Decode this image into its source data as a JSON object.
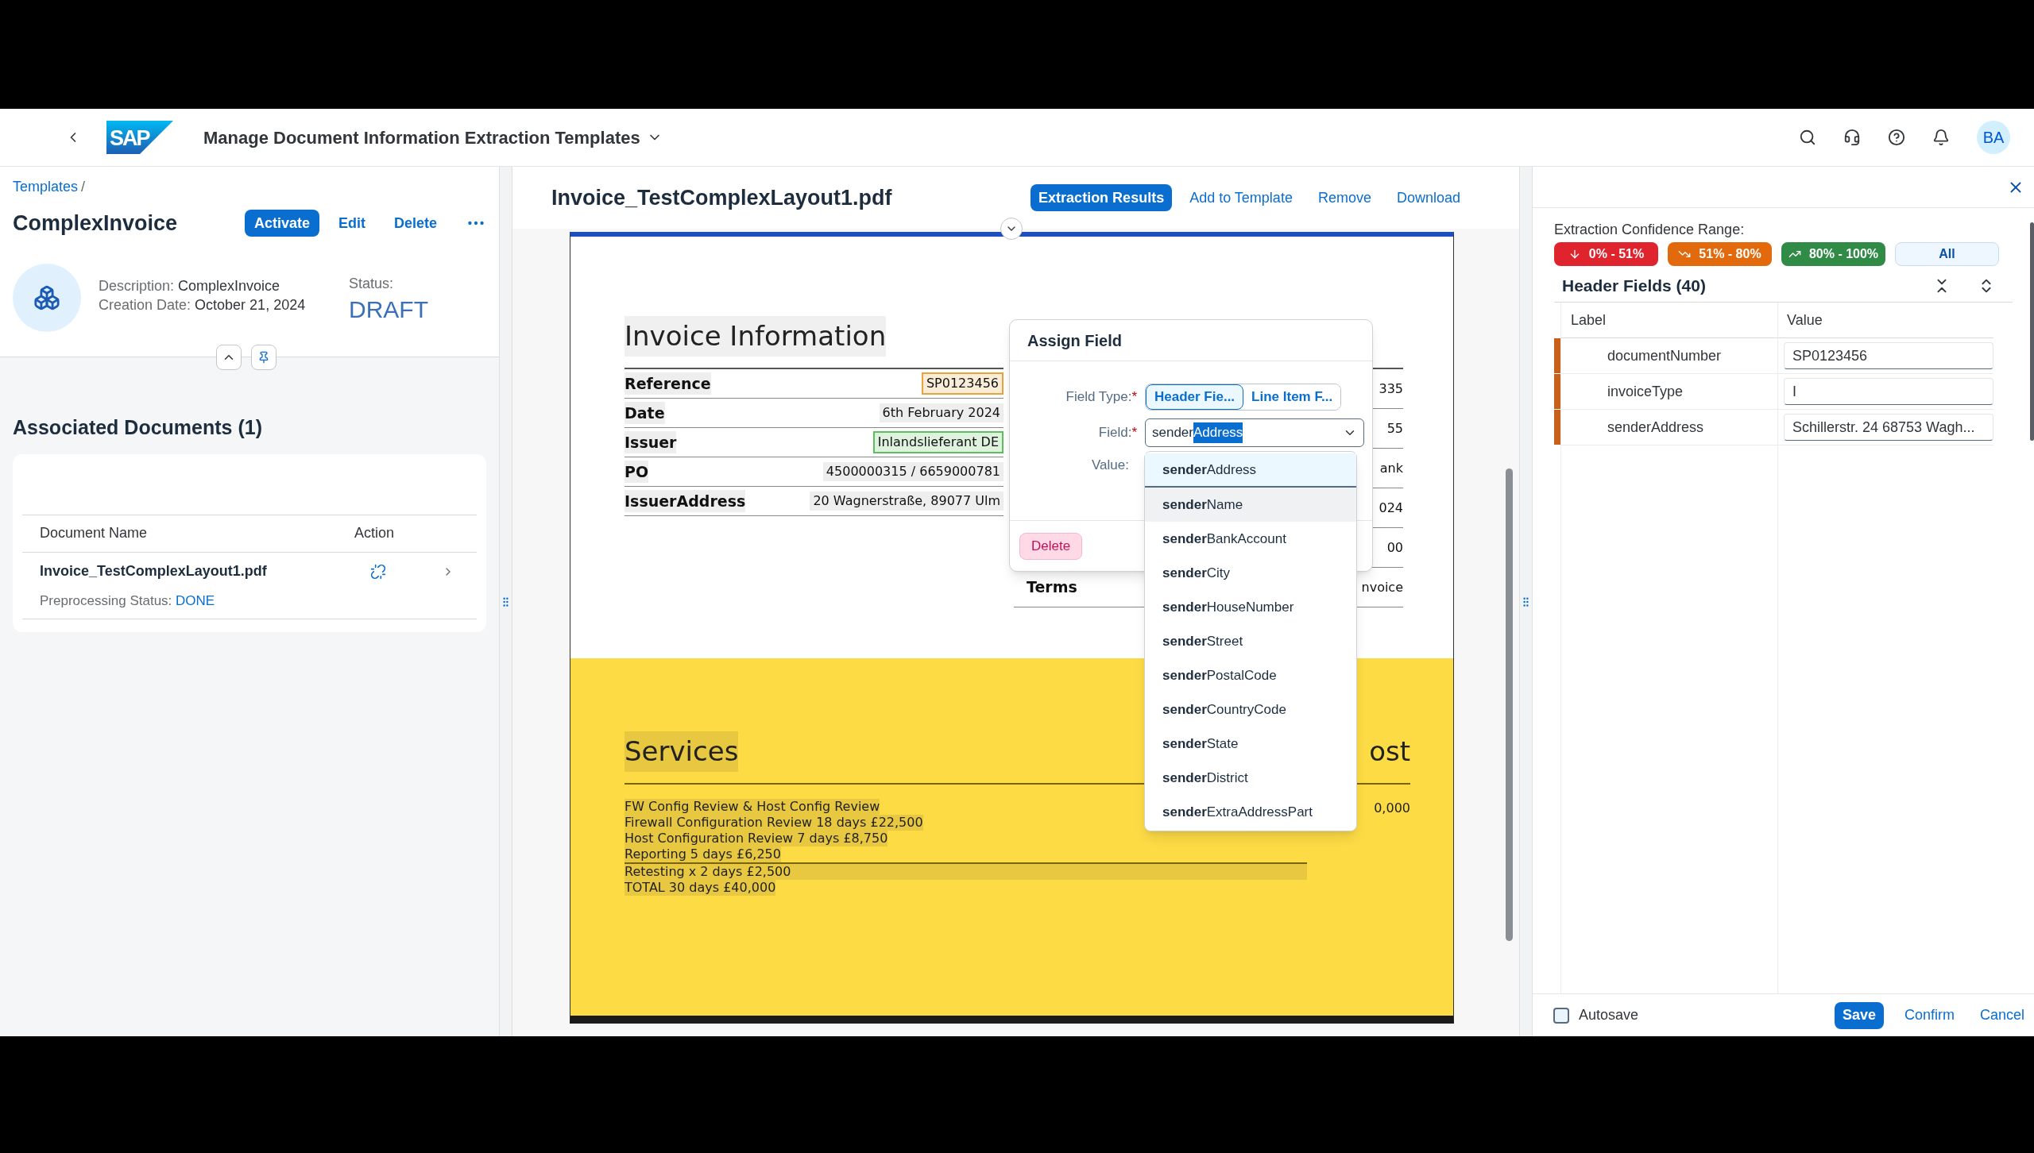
{
  "shell": {
    "logo_text": "SAP",
    "title": "Manage Document Information Extraction Templates",
    "avatar": "BA"
  },
  "template": {
    "breadcrumb": "Templates",
    "breadcrumb_separator": "/",
    "title": "ComplexInvoice",
    "actions": [
      {
        "label": "Activate",
        "kind": "emphasized"
      },
      {
        "label": "Edit",
        "kind": "transparent"
      },
      {
        "label": "Delete",
        "kind": "transparent"
      }
    ],
    "description_label": "Description:",
    "description": "ComplexInvoice",
    "creation_label": "Creation Date:",
    "creation_date": "October 21, 2024",
    "status_label": "Status:",
    "status": "DRAFT"
  },
  "associated": {
    "title": "Associated Documents (1)",
    "columns": [
      "Document Name",
      "Action"
    ],
    "rows": [
      {
        "name": "Invoice_TestComplexLayout1.pdf",
        "status_label": "Preprocessing Status:",
        "status": "DONE"
      }
    ]
  },
  "viewer": {
    "title": "Invoice_TestComplexLayout1.pdf",
    "actions": [
      {
        "label": "Extraction Results",
        "selected": true
      },
      {
        "label": "Add to Template",
        "selected": false
      },
      {
        "label": "Remove",
        "selected": false
      },
      {
        "label": "Download",
        "selected": false
      }
    ]
  },
  "document": {
    "title": "Invoice Information",
    "rows": [
      {
        "label": "Reference",
        "value": "SP0123456",
        "color": "#e8a33d"
      },
      {
        "label": "Date",
        "value": "6th February 2024"
      },
      {
        "label": "Issuer",
        "value": "Inlandslieferant DE",
        "color": "#5cc05c"
      },
      {
        "label": "PO",
        "value": "4500000315 / 6659000781"
      },
      {
        "label": "IssuerAddress",
        "value": "20 Wagnerstraße, 89077 Ulm"
      }
    ],
    "right_rows": [
      {
        "value": "335"
      },
      {
        "value": "55"
      },
      {
        "value": "ank"
      },
      {
        "value": "024"
      },
      {
        "value": "00"
      },
      {
        "label": "Terms",
        "value": "nvoice"
      }
    ],
    "services_title": "Services",
    "services_column": "ost",
    "services_amount": "0,000",
    "service_lines": [
      "FW Config Review & Host Config Review",
      "Firewall Configuration Review 18 days £22,500",
      "Host Configuration Review 7 days £8,750",
      "Reporting 5 days £6,250",
      "Retesting x 2 days £2,500",
      "TOTAL 30 days £40,000"
    ]
  },
  "assign": {
    "title": "Assign Field",
    "field_type_label": "Field Type:",
    "field_label": "Field:",
    "value_label": "Value:",
    "required_mark": "*",
    "field_types": [
      {
        "label": "Header Fie...",
        "selected": true
      },
      {
        "label": "Line Item F...",
        "selected": false
      }
    ],
    "field_typed": "sender",
    "field_autocomplete": "Address",
    "delete": "Delete",
    "options": [
      {
        "text": "**sender**Address",
        "selected": true,
        "hovered": false
      },
      {
        "text": "**sender**Name",
        "selected": false,
        "hovered": true
      },
      {
        "text": "**sender**BankAccount",
        "selected": false,
        "hovered": false
      },
      {
        "text": "**sender**City",
        "selected": false,
        "hovered": false
      },
      {
        "text": "**sender**HouseNumber",
        "selected": false,
        "hovered": false
      },
      {
        "text": "**sender**Street",
        "selected": false,
        "hovered": false
      },
      {
        "text": "**sender**PostalCode",
        "selected": false,
        "hovered": false
      },
      {
        "text": "**sender**CountryCode",
        "selected": false,
        "hovered": false
      },
      {
        "text": "**sender**State",
        "selected": false,
        "hovered": false
      },
      {
        "text": "**sender**District",
        "selected": false,
        "hovered": false
      },
      {
        "text": "**sender**ExtraAddressPart",
        "selected": false,
        "hovered": false
      }
    ]
  },
  "results": {
    "confidence_label": "Extraction Confidence Range:",
    "filters": [
      {
        "label": "0% - 51%",
        "kind": "negative"
      },
      {
        "label": "51% - 80%",
        "kind": "critical"
      },
      {
        "label": "80% - 100%",
        "kind": "positive"
      },
      {
        "label": "All",
        "kind": "all"
      }
    ],
    "section_title": "Header Fields (40)",
    "columns": [
      "Label",
      "Value"
    ],
    "rows": [
      {
        "label": "documentNumber",
        "value": "SP0123456",
        "color": "#c8601a"
      },
      {
        "label": "invoiceType",
        "value": "I",
        "color": "#c8601a"
      },
      {
        "label": "senderAddress",
        "value": "Schillerstr. 24 68753 Wagh...",
        "color": "#c8601a"
      }
    ],
    "autosave_label": "Autosave",
    "autosave_checked": false,
    "save": "Save",
    "confirm": "Confirm",
    "cancel": "Cancel"
  }
}
